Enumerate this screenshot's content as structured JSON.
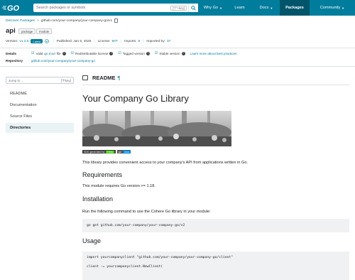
{
  "topnav": {
    "logo": "GO",
    "search_placeholder": "Search packages or symbols",
    "search_shortcut": "[\"/\"+key]",
    "items": [
      {
        "label": "Why Go",
        "caret": true
      },
      {
        "label": "Learn",
        "caret": false
      },
      {
        "label": "Docs",
        "caret": true
      },
      {
        "label": "Packages",
        "caret": false,
        "active": true
      },
      {
        "label": "Community",
        "caret": true
      }
    ]
  },
  "header": {
    "breadcrumb_root": "Discover Packages",
    "breadcrumb_sep": ">",
    "breadcrumb_path": "github.com/your-company/your-company-go/v1",
    "package_name": "api",
    "chips": [
      "package",
      "module"
    ],
    "version_label": "Version:",
    "version": "v1.2.0",
    "latest": "Latest",
    "published": "Published: Jan 6, 2025",
    "license_label": "License:",
    "license": "MIT",
    "imports_label": "Imports:",
    "imports": "8",
    "imported_by_label": "Imported by:",
    "imported_by": "37"
  },
  "details": {
    "label": "Details",
    "checks": [
      {
        "prefix": "Valid",
        "link": "go.mod",
        "suffix": "file"
      },
      {
        "prefix": "Redistributable license",
        "link": "",
        "suffix": ""
      },
      {
        "prefix": "Tagged version",
        "link": "",
        "suffix": ""
      },
      {
        "prefix": "Stable version",
        "link": "",
        "suffix": ""
      }
    ],
    "learn_more": "Learn more about best practices",
    "repo_label": "Repository",
    "repo": "github.com/your-company/your-company-go"
  },
  "sidebar": {
    "jump_placeholder": "Jump to ...",
    "jump_shortcut": "[\"f\"key]",
    "items": [
      {
        "label": "README",
        "active": false
      },
      {
        "label": "Documentation",
        "active": false
      },
      {
        "label": "Source Files",
        "active": false
      },
      {
        "label": "Directories",
        "active": true
      }
    ]
  },
  "main": {
    "readme_title": "README",
    "readme_anchor": "¶",
    "h1": "Your Company Go Library",
    "badge1_left": "SDK generated by",
    "badge1_right": "Fern",
    "badge2_left": "go",
    "badge2_right": "docs",
    "intro": "This library provides convenient access to your company's API from applications written in Go.",
    "req_title": "Requirements",
    "req_text": "This module requires Go version >= 1.18.",
    "install_title": "Installation",
    "install_text": "Run the following command to use the Cohere Go library in your module:",
    "install_code": "go get github.com/your-company/your-company-go/v2",
    "usage_title": "Usage",
    "usage_code_1": "import yourcompanyclient \"github.com/your-company/your-company-go/client\"",
    "usage_code_2": "client := yourcompanyclient.NewClient("
  },
  "colors": {
    "brand": "#007d9c",
    "brand_dark": "#00556b",
    "code_bg": "#f0f1f2"
  }
}
